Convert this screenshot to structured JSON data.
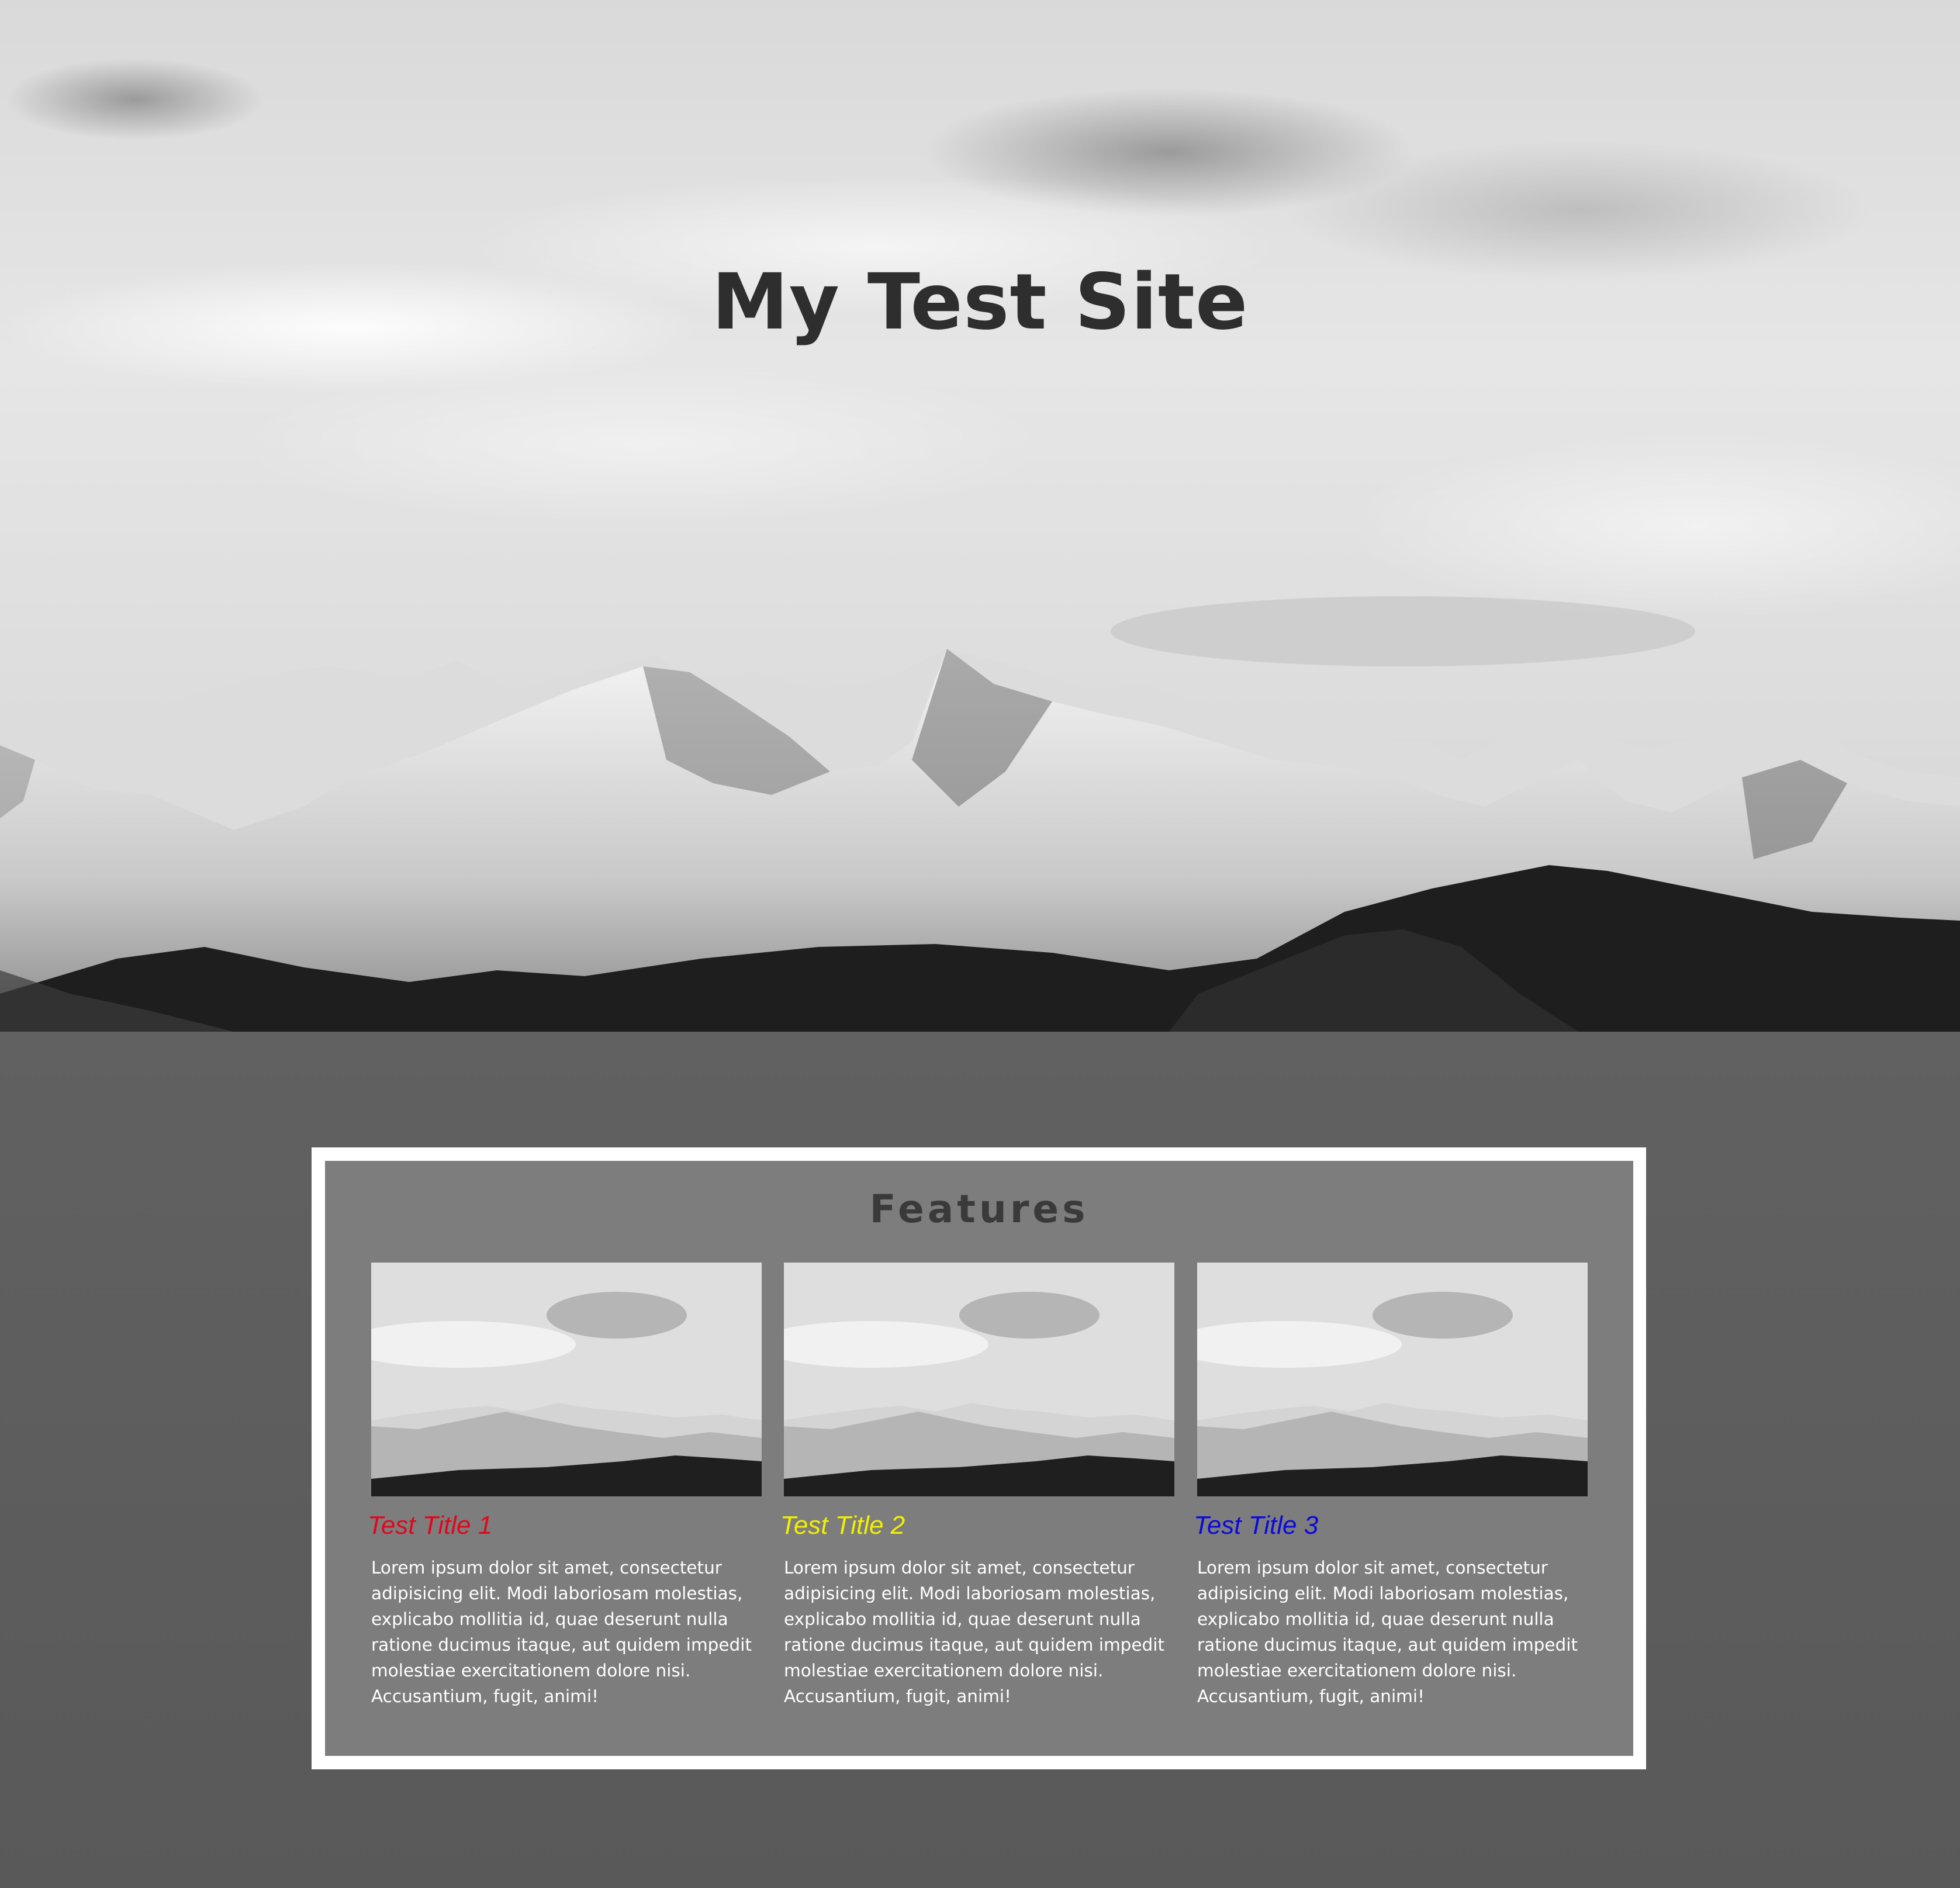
{
  "site": {
    "title": "My Test Site"
  },
  "features": {
    "heading": "Features",
    "cards": [
      {
        "title": "Test Title 1",
        "title_color": "#e0081c",
        "text": "Lorem ipsum dolor sit amet, consectetur adipisicing elit. Modi laboriosam molestias, explicabo mollitia id, quae deserunt nulla ratione ducimus itaque, aut quidem impedit molestiae exercitationem dolore nisi. Accusantium, fugit, animi!"
      },
      {
        "title": "Test Title 2",
        "title_color": "#f2f000",
        "text": "Lorem ipsum dolor sit amet, consectetur adipisicing elit. Modi laboriosam molestias, explicabo mollitia id, quae deserunt nulla ratione ducimus itaque, aut quidem impedit molestiae exercitationem dolore nisi. Accusantium, fugit, animi!"
      },
      {
        "title": "Test Title 3",
        "title_color": "#0a0adc",
        "text": "Lorem ipsum dolor sit amet, consectetur adipisicing elit. Modi laboriosam molestias, explicabo mollitia id, quae deserunt nulla ratione ducimus itaque, aut quidem impedit molestiae exercitationem dolore nisi. Accusantium, fugit, animi!"
      }
    ]
  },
  "colors": {
    "page_background": "#5c5c5c",
    "features_background": "#7d7d7d",
    "frame_border": "#ffffff",
    "heading_text": "#2e2e2e"
  }
}
